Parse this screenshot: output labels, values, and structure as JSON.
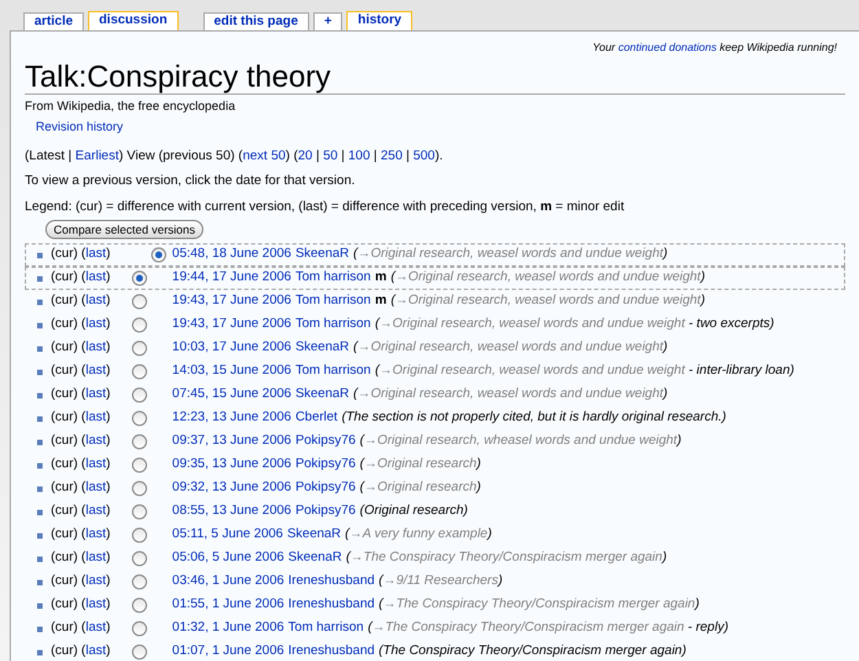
{
  "tabs": [
    {
      "label": "article",
      "selected": false
    },
    {
      "label": "discussion",
      "selected": true
    },
    {
      "label": "edit this page",
      "selected": false
    },
    {
      "label": "+",
      "selected": false
    },
    {
      "label": "history",
      "selected": true
    }
  ],
  "sitenotice": [
    {
      "text": "Your ",
      "link": false
    },
    {
      "text": "continued donations",
      "link": true
    },
    {
      "text": " keep Wikipedia running!",
      "link": false
    }
  ],
  "title": "Talk:Conspiracy theory",
  "tagline": "From Wikipedia, the free encyclopedia",
  "subtitle": "Revision history",
  "nav": [
    {
      "text": "(Latest | ",
      "link": false
    },
    {
      "text": "Earliest",
      "link": true
    },
    {
      "text": ") View (previous 50) (",
      "link": false
    },
    {
      "text": "next 50",
      "link": true
    },
    {
      "text": ") (",
      "link": false
    },
    {
      "text": "20",
      "link": true
    },
    {
      "text": " | ",
      "link": false
    },
    {
      "text": "50",
      "link": true
    },
    {
      "text": " | ",
      "link": false
    },
    {
      "text": "100",
      "link": true
    },
    {
      "text": " | ",
      "link": false
    },
    {
      "text": "250",
      "link": true
    },
    {
      "text": " | ",
      "link": false
    },
    {
      "text": "500",
      "link": true
    },
    {
      "text": ").",
      "link": false
    }
  ],
  "hint": "To view a previous version, click the date for that version.",
  "legend": "Legend: (cur) = difference with current version, (last) = difference with preceding version, **m** = minor edit",
  "compare_button": "Compare selected versions",
  "revisions": [
    {
      "kind": "latest",
      "selected": true,
      "cur": "(cur) (",
      "last": "last",
      "last_close": ")",
      "date": "05:48, 18 June 2006",
      "user": "SkeenaR",
      "summary": [
        {
          "kind": "comment",
          "text": "("
        },
        {
          "kind": "section",
          "text": "→Original research, weasel words and undue weight"
        },
        {
          "kind": "comment",
          "text": ")"
        }
      ]
    },
    {
      "kind": "older",
      "selected": true,
      "cur": "(cur) (",
      "last": "last",
      "last_close": ")",
      "date": "19:44, 17 June 2006",
      "user": "Tom harrison",
      "minor": "m",
      "summary": [
        {
          "kind": "comment",
          "text": "("
        },
        {
          "kind": "section",
          "text": "→Original research, weasel words and undue weight"
        },
        {
          "kind": "comment",
          "text": ")"
        }
      ]
    },
    {
      "kind": "older",
      "selected": false,
      "cur": "(cur) (",
      "last": "last",
      "last_close": ")",
      "date": "19:43, 17 June 2006",
      "user": "Tom harrison",
      "minor": "m",
      "summary": [
        {
          "kind": "comment",
          "text": "("
        },
        {
          "kind": "section",
          "text": "→Original research, weasel words and undue weight"
        },
        {
          "kind": "comment",
          "text": ")"
        }
      ]
    },
    {
      "kind": "older",
      "selected": false,
      "cur": "(cur) (",
      "last": "last",
      "last_close": ")",
      "date": "19:43, 17 June 2006",
      "user": "Tom harrison",
      "summary": [
        {
          "kind": "comment",
          "text": "("
        },
        {
          "kind": "section",
          "text": "→Original research, weasel words and undue weight"
        },
        {
          "kind": "comment",
          "text": " - two excerpts)"
        }
      ]
    },
    {
      "kind": "older",
      "selected": false,
      "cur": "(cur) (",
      "last": "last",
      "last_close": ")",
      "date": "10:03, 17 June 2006",
      "user": "SkeenaR",
      "summary": [
        {
          "kind": "comment",
          "text": "("
        },
        {
          "kind": "section",
          "text": "→Original research, weasel words and undue weight"
        },
        {
          "kind": "comment",
          "text": ")"
        }
      ]
    },
    {
      "kind": "older",
      "selected": false,
      "cur": "(cur) (",
      "last": "last",
      "last_close": ")",
      "date": "14:03, 15 June 2006",
      "user": "Tom harrison",
      "summary": [
        {
          "kind": "comment",
          "text": "("
        },
        {
          "kind": "section",
          "text": "→Original research, weasel words and undue weight"
        },
        {
          "kind": "comment",
          "text": " - inter-library loan)"
        }
      ]
    },
    {
      "kind": "older",
      "selected": false,
      "cur": "(cur) (",
      "last": "last",
      "last_close": ")",
      "date": "07:45, 15 June 2006",
      "user": "SkeenaR",
      "summary": [
        {
          "kind": "comment",
          "text": "("
        },
        {
          "kind": "section",
          "text": "→Original research, weasel words and undue weight"
        },
        {
          "kind": "comment",
          "text": ")"
        }
      ]
    },
    {
      "kind": "older",
      "selected": false,
      "cur": "(cur) (",
      "last": "last",
      "last_close": ")",
      "date": "12:23, 13 June 2006",
      "user": "Cberlet",
      "summary": [
        {
          "kind": "comment",
          "text": "(The section is not properly cited, but it is hardly original research.)"
        }
      ]
    },
    {
      "kind": "older",
      "selected": false,
      "cur": "(cur) (",
      "last": "last",
      "last_close": ")",
      "date": "09:37, 13 June 2006",
      "user": "Pokipsy76",
      "summary": [
        {
          "kind": "comment",
          "text": "("
        },
        {
          "kind": "section",
          "text": "→Original research, wheasel words and undue weight"
        },
        {
          "kind": "comment",
          "text": ")"
        }
      ]
    },
    {
      "kind": "older",
      "selected": false,
      "cur": "(cur) (",
      "last": "last",
      "last_close": ")",
      "date": "09:35, 13 June 2006",
      "user": "Pokipsy76",
      "summary": [
        {
          "kind": "comment",
          "text": "("
        },
        {
          "kind": "section",
          "text": "→Original research"
        },
        {
          "kind": "comment",
          "text": ")"
        }
      ]
    },
    {
      "kind": "older",
      "selected": false,
      "cur": "(cur) (",
      "last": "last",
      "last_close": ")",
      "date": "09:32, 13 June 2006",
      "user": "Pokipsy76",
      "summary": [
        {
          "kind": "comment",
          "text": "("
        },
        {
          "kind": "section",
          "text": "→Original research"
        },
        {
          "kind": "comment",
          "text": ")"
        }
      ]
    },
    {
      "kind": "older",
      "selected": false,
      "cur": "(cur) (",
      "last": "last",
      "last_close": ")",
      "date": "08:55, 13 June 2006",
      "user": "Pokipsy76",
      "summary": [
        {
          "kind": "comment",
          "text": "(Original research)"
        }
      ]
    },
    {
      "kind": "older",
      "selected": false,
      "cur": "(cur) (",
      "last": "last",
      "last_close": ")",
      "date": "05:11, 5 June 2006",
      "user": "SkeenaR",
      "summary": [
        {
          "kind": "comment",
          "text": "("
        },
        {
          "kind": "section",
          "text": "→A very funny example"
        },
        {
          "kind": "comment",
          "text": ")"
        }
      ]
    },
    {
      "kind": "older",
      "selected": false,
      "cur": "(cur) (",
      "last": "last",
      "last_close": ")",
      "date": "05:06, 5 June 2006",
      "user": "SkeenaR",
      "summary": [
        {
          "kind": "comment",
          "text": "("
        },
        {
          "kind": "section",
          "text": "→The Conspiracy Theory/Conspiracism merger again"
        },
        {
          "kind": "comment",
          "text": ")"
        }
      ]
    },
    {
      "kind": "older",
      "selected": false,
      "cur": "(cur) (",
      "last": "last",
      "last_close": ")",
      "date": "03:46, 1 June 2006",
      "user": "Ireneshusband",
      "summary": [
        {
          "kind": "comment",
          "text": "("
        },
        {
          "kind": "section",
          "text": "→9/11 Researchers"
        },
        {
          "kind": "comment",
          "text": ")"
        }
      ]
    },
    {
      "kind": "older",
      "selected": false,
      "cur": "(cur) (",
      "last": "last",
      "last_close": ")",
      "date": "01:55, 1 June 2006",
      "user": "Ireneshusband",
      "summary": [
        {
          "kind": "comment",
          "text": "("
        },
        {
          "kind": "section",
          "text": "→The Conspiracy Theory/Conspiracism merger again"
        },
        {
          "kind": "comment",
          "text": ")"
        }
      ]
    },
    {
      "kind": "older",
      "selected": false,
      "cur": "(cur) (",
      "last": "last",
      "last_close": ")",
      "date": "01:32, 1 June 2006",
      "user": "Tom harrison",
      "summary": [
        {
          "kind": "comment",
          "text": "("
        },
        {
          "kind": "section",
          "text": "→The Conspiracy Theory/Conspiracism merger again"
        },
        {
          "kind": "comment",
          "text": " - reply)"
        }
      ]
    },
    {
      "kind": "older",
      "selected": false,
      "cur": "(cur) (",
      "last": "last",
      "last_close": ")",
      "date": "01:07, 1 June 2006",
      "user": "Ireneshusband",
      "summary": [
        {
          "kind": "comment",
          "text": "(The Conspiracy Theory/Conspiracism merger again)"
        }
      ]
    }
  ]
}
